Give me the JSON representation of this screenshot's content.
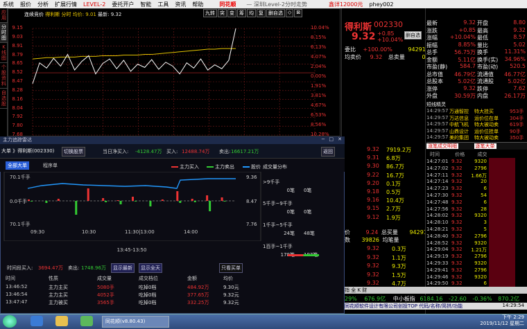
{
  "menu": {
    "items": [
      "系统",
      "报价",
      "分析",
      "扩展行情",
      "LEVEL-2",
      "委托开户",
      "智能",
      "工具",
      "资讯",
      "帮助"
    ],
    "logo": "同花顺",
    "title": "— 深圳Level-2分时走势",
    "clock": "鑫详12000元",
    "user": "phey002"
  },
  "left_tabs": [
    "应用",
    "分时图",
    "K线图",
    "个股资料",
    "自选股"
  ],
  "chart": {
    "title": "连续竞价",
    "name": "得利斯",
    "time_label": "分时",
    "avg_label": "均价: 9.01",
    "last_label": "最新: 9.32",
    "left_ticks": [
      "9.15",
      "9.03",
      "8.91",
      "8.79",
      "8.65",
      "8.52",
      "8.47",
      "8.28",
      "8.16",
      "8.04",
      "7.92",
      "7.80",
      "7.68"
    ],
    "right_ticks": [
      "10.04%",
      "8.15%",
      "6.13%",
      "4.07%",
      "2.04%",
      "0.00%",
      "1.91%",
      "3.81%",
      "4.67%",
      "6.53%",
      "8.56%",
      "10.28%"
    ],
    "buttons": [
      "九转",
      "突",
      "变",
      "筹",
      "均",
      "复",
      "删自选",
      "◇",
      "⊠"
    ],
    "price_series": [
      8.47,
      8.79,
      8.71,
      8.86,
      8.74,
      8.92,
      8.68,
      8.81,
      8.9,
      8.62,
      8.78,
      8.85,
      8.7,
      8.83,
      8.66,
      8.77,
      8.72,
      8.84,
      8.69,
      8.8,
      8.74,
      8.62,
      8.79,
      8.71,
      8.85,
      8.68,
      8.76,
      8.7,
      8.83,
      9.32
    ],
    "avg_series": [
      8.85,
      8.86,
      8.87,
      8.87,
      8.88,
      8.88,
      8.88,
      8.89,
      8.89,
      8.89,
      8.9,
      8.9,
      8.9,
      8.91,
      8.91,
      8.91,
      8.92,
      8.92,
      8.93,
      8.94,
      8.95,
      8.96,
      8.97,
      8.98,
      8.99,
      9.0,
      9.0,
      9.01,
      9.01,
      9.01
    ],
    "colors": {
      "price": "#ffffff",
      "avg": "#e5c300",
      "grid": "#7a1a1a",
      "base": "#888"
    }
  },
  "quote": {
    "name": "得利斯",
    "code": "002330",
    "price": "9.32",
    "chg": "+0.85",
    "pct": "+10.04%",
    "ref_btn": "删自选",
    "weibi": "委比",
    "weibi_val": "+100.00%",
    "weicha_val": "94291",
    "avg_label": "均卖价",
    "avg_val": "9.32",
    "total_sell": "总卖量",
    "total_sell_val": "0",
    "buys": [
      [
        "9.32",
        "7919.2万"
      ],
      [
        "9.31",
        "6.8万"
      ],
      [
        "9.30",
        "86.7万"
      ],
      [
        "9.22",
        "16.7万"
      ],
      [
        "9.20",
        "0.1万"
      ],
      [
        "9.18",
        "0.5万"
      ],
      [
        "9.16",
        "10.4万"
      ],
      [
        "9.15",
        "2.7万"
      ],
      [
        "9.12",
        "1.9万"
      ]
    ],
    "price2": "9.24",
    "total_buy2": "总买量",
    "tb_val": "94291",
    "vol": "39826",
    "vol_label": "均笔量",
    "vol_val": "14",
    "ticks": [
      [
        "9.32",
        "0.3万"
      ],
      [
        "9.32",
        "1.1万"
      ],
      [
        "9.32",
        "9.3万"
      ],
      [
        "9.32",
        "1.5万"
      ],
      [
        "9.32",
        "4.7万"
      ]
    ]
  },
  "right": {
    "stats": [
      [
        "最新",
        "9.32",
        "开盘",
        "8.80"
      ],
      [
        "涨跌",
        "+0.85",
        "最高",
        "9.32"
      ],
      [
        "涨幅",
        "+10.04%",
        "最低",
        "8.57"
      ],
      [
        "振幅",
        "8.85%",
        "量比",
        "5.02"
      ],
      [
        "总手",
        "56.75万",
        "换手",
        "11.31%"
      ],
      [
        "金额",
        "5.11亿",
        "换手(实)",
        "34.96%"
      ],
      [
        "市盈(静)",
        "584.7",
        "市盈(动)",
        "520.5"
      ],
      [
        "总市值",
        "46.79亿",
        "流通值",
        "46.77亿"
      ],
      [
        "总股本",
        "5.02亿",
        "流通股",
        "5.02亿"
      ],
      [
        "涨停",
        "9.32",
        "跌停",
        "7.62"
      ],
      [
        "外盘",
        "30.59万",
        "内盘",
        "26.17万"
      ]
    ],
    "news_title": "短线精灵",
    "news": [
      [
        "14:29:57",
        "万通智控",
        "特大挂买",
        "953手"
      ],
      [
        "14:29:57",
        "万达信息",
        "运价位在单",
        "304手"
      ],
      [
        "14:29:57",
        "中航飞机",
        "特大被动卖",
        "619手"
      ],
      [
        "14:29:57",
        "山鼎设计",
        "运价位挂单",
        "90手"
      ],
      [
        "14:29:57",
        "美的集团",
        "特大被动卖",
        "350手"
      ]
    ],
    "trade_tabs": [
      "涨笔成交明细",
      "逐笔大单"
    ],
    "trade_head": [
      "时间",
      "价格",
      "成交"
    ],
    "trades": [
      [
        "14:27:01",
        "9.32",
        "9320"
      ],
      [
        "14:27:02",
        "9.32",
        "2796"
      ],
      [
        "14:27:11",
        "9.32",
        "1.66万"
      ],
      [
        "14:27:14",
        "9.32",
        "20"
      ],
      [
        "14:27:23",
        "9.32",
        "6"
      ],
      [
        "14:27:30",
        "9.32",
        "54"
      ],
      [
        "14:27:48",
        "9.32",
        "6"
      ],
      [
        "14:27:56",
        "9.32",
        "28"
      ],
      [
        "14:28:02",
        "9.32",
        "9320"
      ],
      [
        "14:28:10",
        "9.32",
        "3"
      ],
      [
        "14:28:21",
        "9.32",
        "5"
      ],
      [
        "14:28:40",
        "9.32",
        "2796"
      ],
      [
        "14:28:52",
        "9.32",
        "9320"
      ],
      [
        "14:29:04",
        "9.32",
        "1.21万"
      ],
      [
        "14:29:19",
        "9.32",
        "2796"
      ],
      [
        "14:29:33",
        "9.32",
        "9320"
      ],
      [
        "14:29:41",
        "9.32",
        "2796"
      ],
      [
        "14:29:46",
        "9.32",
        "9320"
      ],
      [
        "14:29:50",
        "9.32",
        "6"
      ]
    ]
  },
  "overlay": {
    "title": "主力追踪雷达",
    "stock": "大单 》得利斯(002330)",
    "switch_btn": "切换股票",
    "net_buy_label": "当日净买入:",
    "net_buy": "-4128.47万",
    "buy_label": "买入:",
    "buy": "12488.74万",
    "sell_label": "卖出:",
    "sell": "16617.21万",
    "tab_main": "全部大单",
    "tab_seq": "程序单",
    "return_btn": "返回",
    "legend": [
      "主力买入",
      "主力卖出",
      "股价",
      "成交量分布"
    ],
    "y_top": "70.1千手",
    "y_mid": "0.0千手",
    "y_bot": "70.1千手",
    "x_ticks": [
      "09:30",
      "10:30",
      "11:30|13:00",
      "14:00"
    ],
    "r_top": "9.36",
    "r_mid": "8.47",
    "r_bot": "7.76",
    "time_range": "13:45-13:50",
    "flows": [
      {
        "label": ">9千手",
        "a": "0笔",
        "b": "0笔"
      },
      {
        "label": "5千手~9千手",
        "a": "0笔",
        "b": "0笔"
      },
      {
        "label": "1千手~5千手",
        "a": "24笔",
        "b": "48笔"
      },
      {
        "label": "1百手~1千手",
        "a": "178笔",
        "b": "197笔"
      }
    ],
    "period_buy_label": "时间段买入:",
    "period_buy": "3694.47万",
    "period_sell_label": "卖出:",
    "period_sell": "1748.96万",
    "show_latest": "显示最新",
    "show_all": "显示全天",
    "filter": "只看买单",
    "table_head": [
      "时间",
      "性质",
      "成交量",
      "成交档位",
      "金额",
      "均价"
    ],
    "rows": [
      [
        "13:46:52",
        "主力主买",
        "5080手",
        "吃掉0档",
        "484.92万",
        "9.30元"
      ],
      [
        "13:46:54",
        "主力主买",
        "4052手",
        "吃掉0档",
        "377.65万",
        "9.32元"
      ],
      [
        "13:47:47",
        "主力被买",
        "3565手",
        "吃掉0档",
        "332.25万",
        "9.32元"
      ]
    ],
    "buy_vol": [
      2,
      0,
      3,
      0,
      18,
      4,
      1,
      6,
      0,
      2,
      14,
      3,
      8,
      5
    ],
    "sell_vol": [
      1,
      3,
      0,
      20,
      0,
      2,
      5,
      1,
      8,
      0,
      3,
      2,
      15,
      1
    ]
  },
  "bottom": {
    "strip_label": "指 全 K 财",
    "idx_a": "29%",
    "idx_b": "676.9亿",
    "idx_c": "中小板指",
    "idx_d": "6184.16",
    "idx_e": "-22.60",
    "idx_f": "-0.36%",
    "idx_g": "870.2亿",
    "banner": "同花顺软件设计有限公司创投TOP 代码/名称/简拼/功能",
    "time_disp": "14:29:54"
  },
  "taskbar": {
    "app": "同花顺(v8.80.43)",
    "time": "下午 2:29",
    "date": "2019/11/12 星期二"
  }
}
